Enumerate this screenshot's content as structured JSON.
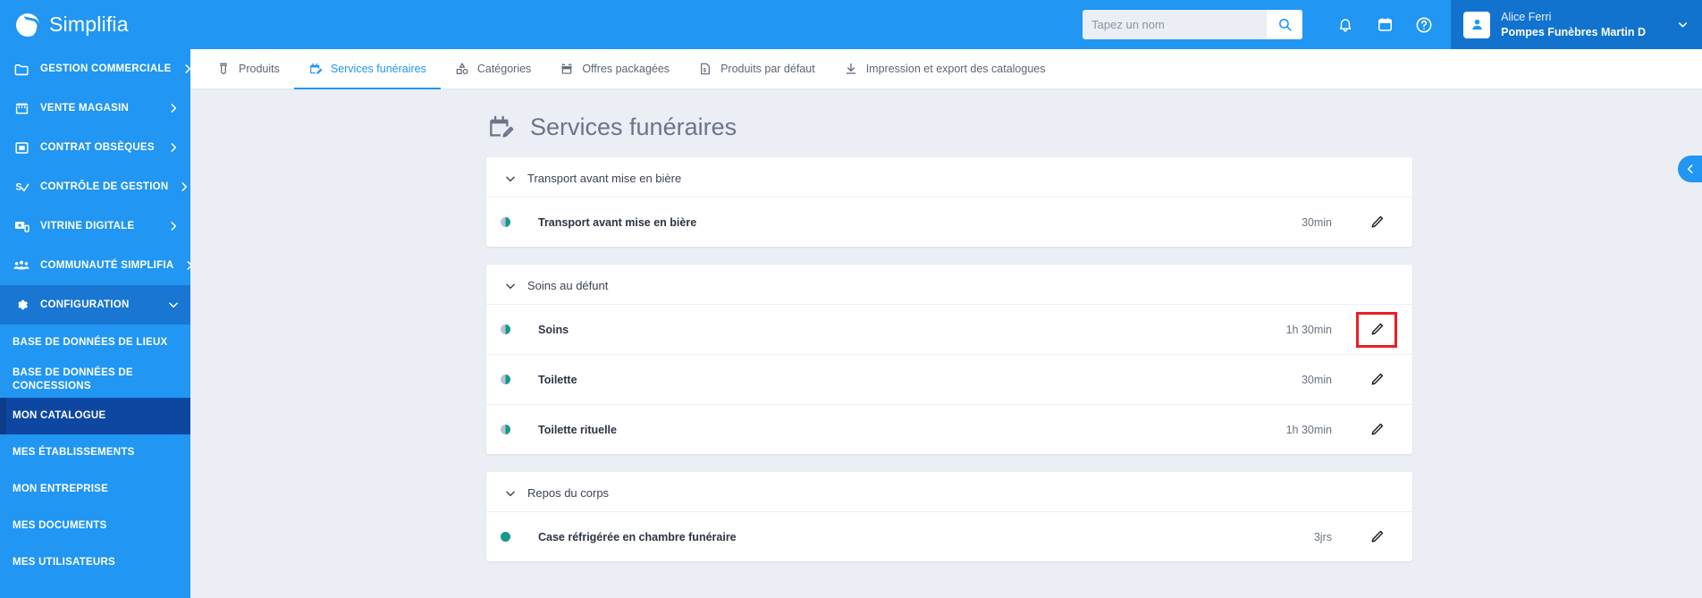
{
  "brand": {
    "name": "Simplifia",
    "logo_icon": "simplifia-logo-icon"
  },
  "header": {
    "search": {
      "placeholder": "Tapez un nom",
      "value": "",
      "icon": "search-icon"
    },
    "notifications_icon": "bell-icon",
    "calendar_icon": "calendar-icon",
    "help_icon": "help-circle-icon",
    "user": {
      "avatar_icon": "user-avatar-icon",
      "name": "Alice Ferri",
      "organization": "Pompes Funèbres Martin D",
      "caret_icon": "chevron-down-icon"
    }
  },
  "sidebar": {
    "items": [
      {
        "label": "GESTION COMMERCIALE",
        "icon": "folder-icon",
        "chevron": "chevron-right-icon",
        "active": false
      },
      {
        "label": "VENTE MAGASIN",
        "icon": "store-icon",
        "chevron": "chevron-right-icon",
        "active": false
      },
      {
        "label": "CONTRAT OBSÈQUES",
        "icon": "contract-icon",
        "chevron": "chevron-right-icon",
        "active": false
      },
      {
        "label": "CONTRÔLE DE GESTION",
        "icon": "money-check-icon",
        "chevron": "chevron-right-icon",
        "active": false
      },
      {
        "label": "VITRINE DIGITALE",
        "icon": "monitor-star-icon",
        "chevron": "chevron-right-icon",
        "active": false
      },
      {
        "label": "COMMUNAUTÉ SIMPLIFIA",
        "icon": "people-icon",
        "chevron": "chevron-right-icon",
        "active": false
      },
      {
        "label": "CONFIGURATION",
        "icon": "gear-icon",
        "chevron": "chevron-down-icon",
        "active": true
      }
    ],
    "sub_items": [
      {
        "label": "BASE DE DONNÉES DE LIEUX",
        "selected": false
      },
      {
        "label": "BASE DE DONNÉES DE CONCESSIONS",
        "selected": false
      },
      {
        "label": "MON CATALOGUE",
        "selected": true
      },
      {
        "label": "MES ÉTABLISSEMENTS",
        "selected": false
      },
      {
        "label": "MON ENTREPRISE",
        "selected": false
      },
      {
        "label": "MES DOCUMENTS",
        "selected": false
      },
      {
        "label": "MES UTILISATEURS",
        "selected": false
      }
    ]
  },
  "tabs": [
    {
      "label": "Produits",
      "icon": "urn-icon",
      "active": false
    },
    {
      "label": "Services funéraires",
      "icon": "calendar-edit-icon",
      "active": true
    },
    {
      "label": "Catégories",
      "icon": "shapes-icon",
      "active": false
    },
    {
      "label": "Offres packagées",
      "icon": "gift-box-icon",
      "active": false
    },
    {
      "label": "Produits par défaut",
      "icon": "document-euro-icon",
      "active": false
    },
    {
      "label": "Impression et export des catalogues",
      "icon": "download-icon",
      "active": false
    }
  ],
  "page": {
    "title": "Services funéraires",
    "title_icon": "calendar-edit-icon",
    "collapse_handle_icon": "chevron-left-icon"
  },
  "groups": [
    {
      "title": "Transport avant mise en bière",
      "chevron": "chevron-down-icon",
      "rows": [
        {
          "label": "Transport avant mise en bière",
          "duration": "30min",
          "status": "half",
          "edit_icon": "pencil-icon",
          "highlighted": false
        }
      ]
    },
    {
      "title": "Soins au défunt",
      "chevron": "chevron-down-icon",
      "rows": [
        {
          "label": "Soins",
          "duration": "1h 30min",
          "status": "half",
          "edit_icon": "pencil-icon",
          "highlighted": true
        },
        {
          "label": "Toilette",
          "duration": "30min",
          "status": "half",
          "edit_icon": "pencil-icon",
          "highlighted": false
        },
        {
          "label": "Toilette rituelle",
          "duration": "1h 30min",
          "status": "half",
          "edit_icon": "pencil-icon",
          "highlighted": false
        }
      ]
    },
    {
      "title": "Repos du corps",
      "chevron": "chevron-down-icon",
      "rows": [
        {
          "label": "Case réfrigérée en chambre funéraire",
          "duration": "3jrs",
          "status": "full",
          "edit_icon": "pencil-icon",
          "highlighted": false
        }
      ]
    }
  ],
  "colors": {
    "brand_blue": "#2196f3",
    "sidebar_active": "#1976d2",
    "sub_selected": "#0d47a1",
    "status_teal": "#17998c",
    "highlight_red": "#ee1c25",
    "page_bg": "#eceef5"
  }
}
